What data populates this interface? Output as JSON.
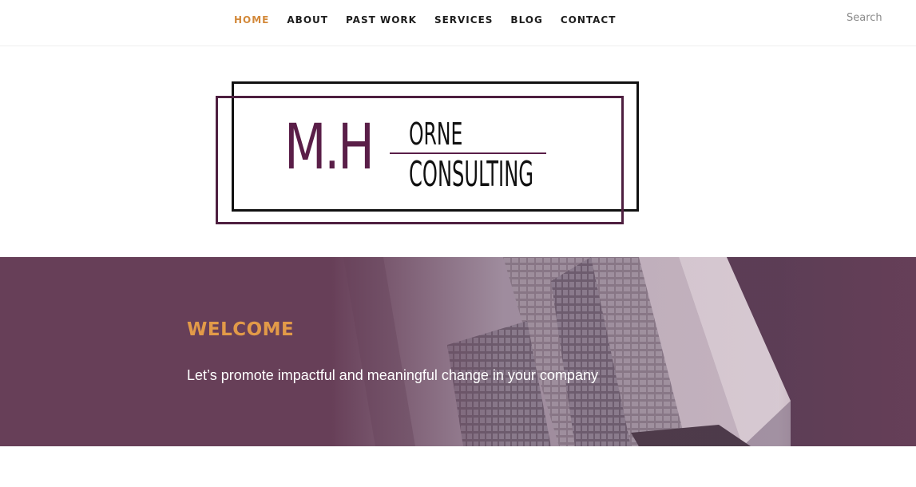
{
  "nav": {
    "items": [
      {
        "label": "HOME",
        "active": true
      },
      {
        "label": "ABOUT",
        "active": false
      },
      {
        "label": "PAST WORK",
        "active": false
      },
      {
        "label": "SERVICES",
        "active": false
      },
      {
        "label": "BLOG",
        "active": false
      },
      {
        "label": "CONTACT",
        "active": false
      }
    ]
  },
  "search": {
    "placeholder": "Search",
    "value": ""
  },
  "logo": {
    "initials": "M.H",
    "line1": "ORNE",
    "line2": "CONSULTING"
  },
  "hero": {
    "title": "WELCOME",
    "subtitle": "Let’s promote impactful and meaningful change in your company"
  },
  "colors": {
    "accent": "#d3893a",
    "brand_purple": "#5a1e48",
    "hero_overlay": "#673f58",
    "hero_title": "#e29a48"
  }
}
